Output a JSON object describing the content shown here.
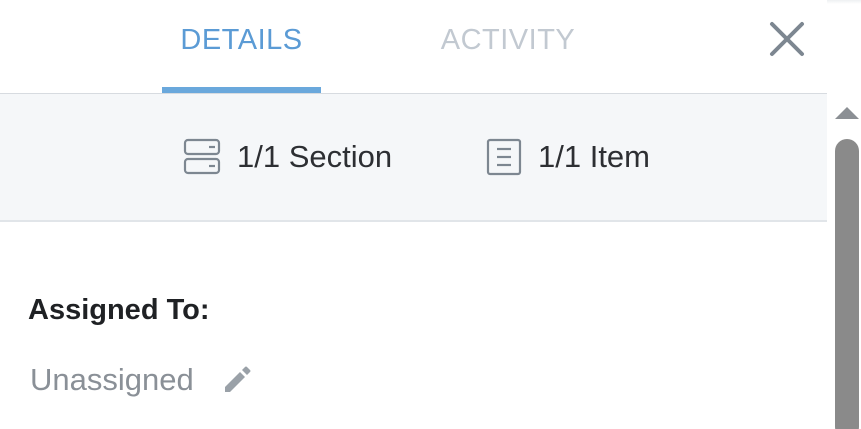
{
  "tabs": {
    "details": "DETAILS",
    "activity": "ACTIVITY",
    "active": "details"
  },
  "summary": {
    "sections": "1/1 Section",
    "items": "1/1 Item"
  },
  "assignment": {
    "label": "Assigned To:",
    "value": "Unassigned"
  },
  "icons": {
    "close": "close-icon",
    "sections": "sections-icon",
    "items": "document-icon",
    "edit": "pencil-icon"
  },
  "colors": {
    "accent": "#5b9bd5",
    "inactive_tab": "#c2c9d1",
    "muted_text": "#8a9097",
    "band": "#f5f7f9"
  }
}
